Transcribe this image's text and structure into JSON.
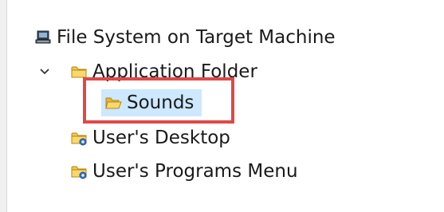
{
  "tree": {
    "root": {
      "label": "File System on Target Machine",
      "icon": "computer-icon"
    },
    "items": [
      {
        "label": "Application Folder",
        "icon": "folder-icon",
        "expanded": true,
        "expander_icon": "chevron-down-icon"
      },
      {
        "label": "Sounds",
        "icon": "open-folder-icon",
        "selected": true,
        "parent": "Application Folder"
      },
      {
        "label": "User's Desktop",
        "icon": "special-folder-icon"
      },
      {
        "label": "User's Programs Menu",
        "icon": "special-folder-icon"
      }
    ]
  },
  "colors": {
    "selection": "#cde8ff",
    "highlight_border": "#e04848",
    "folder": "#f5c64a",
    "folder_dark": "#d9a521"
  }
}
